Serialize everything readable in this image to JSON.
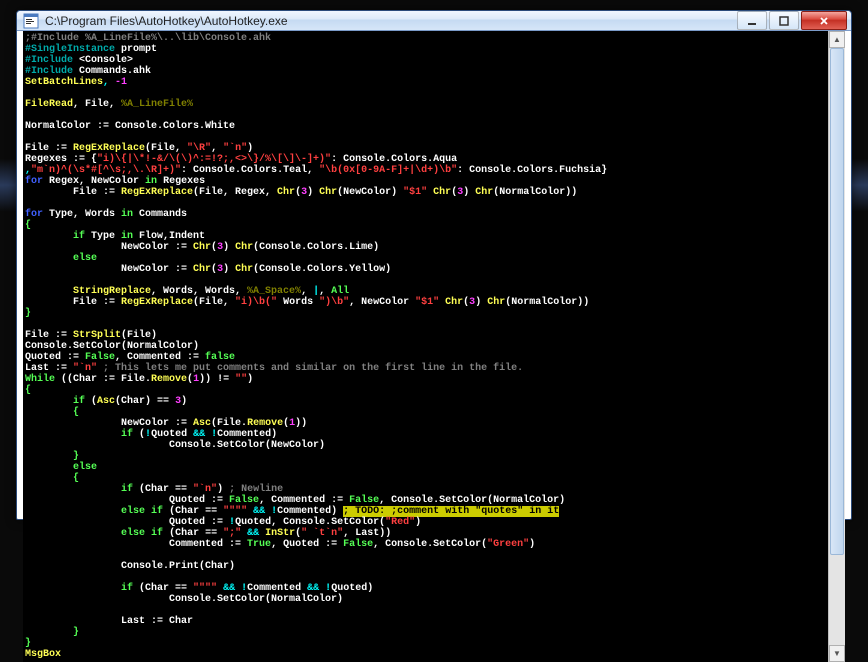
{
  "window": {
    "title": "C:\\Program Files\\AutoHotkey\\AutoHotkey.exe"
  },
  "colors": {
    "gray": "#808080",
    "olive": "#808000",
    "white": "#ffffff",
    "red": "#ff4040",
    "teal": "#00aaaa",
    "aqua": "#00ffff",
    "yellow": "#ffff55",
    "blue": "#4060ff",
    "lime": "#55ff55",
    "purple": "#a040c0",
    "fuchsia": "#ff40ff"
  },
  "code": {
    "l01a": ";#Include %A_LineFile%\\..\\lib\\Console.ahk",
    "l02a": "#SingleInstance",
    "l02b": " prompt",
    "l03a": "#Include",
    "l03b": " <Console>",
    "l04a": "#Include",
    "l04b": " Commands.ahk",
    "l05a": "SetBatchLines",
    "l05b": ", ",
    "l05c": "-1",
    "l07a": "FileRead",
    "l07b": ", File, ",
    "l07c": "%A_LineFile%",
    "l09a": "NormalColor := Console.Colors.White",
    "l11a": "File := ",
    "l11b": "RegExReplace",
    "l11c": "(File, ",
    "l11d": "\"\\R\"",
    "l11e": ", ",
    "l11f": "\"`n\"",
    "l11g": ")",
    "l12a": "Regexes := {",
    "l12b": "\"i)\\{|\\*!-&/\\(\\)^:=!?;,<>\\}/%\\[\\]\\-]+)\"",
    "l12c": ": Console.Colors.Aqua",
    "l13a": ",",
    "l13b": "\"m`n)^(\\s*#[^\\s;,\\.\\R]+)\"",
    "l13c": ": Console.Colors.Teal, ",
    "l13d": "\"\\b(0x[0-9A-F]+|\\d+)\\b\"",
    "l13e": ": Console.Colors.Fuchsia}",
    "l14a": "for",
    "l14b": " Regex, NewColor ",
    "l14c": "in",
    "l14d": " Regexes",
    "l15a": "        File := ",
    "l15b": "RegExReplace",
    "l15c": "(File, Regex, ",
    "l15d": "Chr",
    "l15e": "(",
    "l15f": "3",
    "l15g": ") ",
    "l15h": "Chr",
    "l15i": "(NewColor) ",
    "l15j": "\"$1\"",
    "l15k": " ",
    "l15l": "Chr",
    "l15m": "(",
    "l15n": "3",
    "l15o": ") ",
    "l15p": "Chr",
    "l15q": "(NormalColor))",
    "l17a": "for",
    "l17b": " Type, Words ",
    "l17c": "in",
    "l17d": " Commands",
    "l18a": "{",
    "l19a": "        if",
    "l19b": " Type ",
    "l19c": "in",
    "l19d": " Flow,Indent",
    "l20a": "                NewColor := ",
    "l20b": "Chr",
    "l20c": "(",
    "l20d": "3",
    "l20e": ") ",
    "l20f": "Chr",
    "l20g": "(Console.Colors.Lime)",
    "l21a": "        else",
    "l22a": "                NewColor := ",
    "l22b": "Chr",
    "l22c": "(",
    "l22d": "3",
    "l22e": ") ",
    "l22f": "Chr",
    "l22g": "(Console.Colors.Yellow)",
    "l24a": "        StringReplace",
    "l24b": ", Words, Words, ",
    "l24c": "%A_Space%",
    "l24d": ", ",
    "l24e": "|",
    "l24f": ", ",
    "l24g": "All",
    "l25a": "        File := ",
    "l25b": "RegExReplace",
    "l25c": "(File, ",
    "l25d": "\"i)\\b(\"",
    "l25e": " Words ",
    "l25f": "\")\\b\"",
    "l25g": ", NewColor ",
    "l25h": "\"$1\"",
    "l25i": " ",
    "l25j": "Chr",
    "l25k": "(",
    "l25l": "3",
    "l25m": ") ",
    "l25n": "Chr",
    "l25o": "(NormalColor))",
    "l26a": "}",
    "l28a": "File := ",
    "l28b": "StrSplit",
    "l28c": "(File)",
    "l29a": "Console.SetColor(NormalColor)",
    "l30a": "Quoted := ",
    "l30b": "False",
    "l30c": ", Commented := ",
    "l30d": "false",
    "l31a": "Last := ",
    "l31b": "\"`n\"",
    "l31c": " ; This lets me put comments and similar on the first line in the file.",
    "l32a": "While",
    "l32b": " ((Char := File.",
    "l32c": "Remove",
    "l32d": "(",
    "l32e": "1",
    "l32f": ")) != ",
    "l32g": "\"\"",
    "l32h": ")",
    "l33a": "{",
    "l34a": "        if",
    "l34b": " (",
    "l34c": "Asc",
    "l34d": "(Char) == ",
    "l34e": "3",
    "l34f": ")",
    "l35a": "        {",
    "l36a": "                NewColor := ",
    "l36b": "Asc",
    "l36c": "(File.",
    "l36d": "Remove",
    "l36e": "(",
    "l36f": "1",
    "l36g": "))",
    "l37a": "                if",
    "l37b": " (",
    "l37c": "!",
    "l37d": "Quoted ",
    "l37e": "&&",
    "l37f": " ",
    "l37g": "!",
    "l37h": "Commented)",
    "l38a": "                        Console.SetColor(NewColor)",
    "l39a": "        }",
    "l40a": "        else",
    "l41a": "        {",
    "l42a": "                if",
    "l42b": " (Char == ",
    "l42c": "\"`n\"",
    "l42d": ") ",
    "l42e": "; Newline",
    "l43a": "                        Quoted := ",
    "l43b": "False",
    "l43c": ", Commented := ",
    "l43d": "False",
    "l43e": ", Console.SetColor(NormalColor)",
    "l44a": "                else",
    "l44b": " ",
    "l44c": "if",
    "l44d": " (Char == ",
    "l44e": "\"\"\"\"",
    "l44f": " ",
    "l44g": "&&",
    "l44h": " ",
    "l44i": "!",
    "l44j": "Commented) ",
    "l44k": "; TODO: ;comment with \"quotes\" in it",
    "l45a": "                        Quoted := ",
    "l45b": "!",
    "l45c": "Quoted, Console.SetColor(",
    "l45d": "\"Red\"",
    "l45e": ")",
    "l46a": "                else",
    "l46b": " ",
    "l46c": "if",
    "l46d": " (Char == ",
    "l46e": "\";\"",
    "l46f": " ",
    "l46g": "&&",
    "l46h": " ",
    "l46i": "InStr",
    "l46j": "(",
    "l46k": "\" `t`n\"",
    "l46l": ", Last))",
    "l47a": "                        Commented := ",
    "l47b": "True",
    "l47c": ", Quoted := ",
    "l47d": "False",
    "l47e": ", Console.SetColor(",
    "l47f": "\"Green\"",
    "l47g": ")",
    "l49a": "                Console.Print(Char)",
    "l51a": "                if",
    "l51b": " (Char == ",
    "l51c": "\"\"\"\"",
    "l51d": " ",
    "l51e": "&&",
    "l51f": " ",
    "l51g": "!",
    "l51h": "Commented ",
    "l51i": "&&",
    "l51j": " ",
    "l51k": "!",
    "l51l": "Quoted)",
    "l52a": "                        Console.SetColor(NormalColor)",
    "l54a": "                Last := Char",
    "l55a": "        }",
    "l56a": "}",
    "l57a": "MsgBox"
  }
}
